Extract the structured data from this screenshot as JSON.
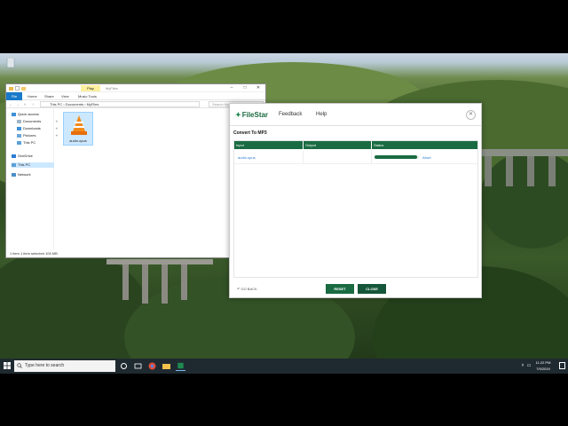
{
  "explorer": {
    "tag": "Play",
    "window_name": "MyFiles",
    "ribbon_tabs": [
      "File",
      "Home",
      "Share",
      "View",
      "Music Tools"
    ],
    "path": [
      "This PC",
      "Documents",
      "MyFiles"
    ],
    "search_placeholder": "Search MyFiles",
    "nav_items": [
      {
        "label": "Quick access",
        "icon": "star-icon"
      },
      {
        "label": "Documents",
        "icon": "documents-icon"
      },
      {
        "label": "Downloads",
        "icon": "download-icon"
      },
      {
        "label": "Pictures",
        "icon": "pictures-icon"
      },
      {
        "label": "This PC",
        "icon": "computer-icon"
      },
      {
        "label": "OneDrive",
        "icon": "cloud-icon"
      },
      {
        "label": "This PC",
        "icon": "computer-icon"
      },
      {
        "label": "Network",
        "icon": "network-icon"
      }
    ],
    "file_name": "audio.opus",
    "status": "1 item    1 item selected  105 MB"
  },
  "dialog": {
    "logo_text": "FileStar",
    "menu": [
      "Feedback",
      "Help"
    ],
    "heading": "Convert To MP3",
    "columns": [
      "Input",
      "Output",
      "Status"
    ],
    "row": {
      "input": "audio.opus",
      "output": "",
      "progress": 0.95,
      "action": "Abort"
    },
    "go_back": "GO BACK",
    "reset": "RESET",
    "close": "CLOSE"
  },
  "taskbar": {
    "search_placeholder": "Type here to search",
    "time": "11:22 PM",
    "date": "7/9/2019"
  },
  "colors": {
    "accent": "#1a6b42",
    "explorer_blue": "#1979ca"
  }
}
